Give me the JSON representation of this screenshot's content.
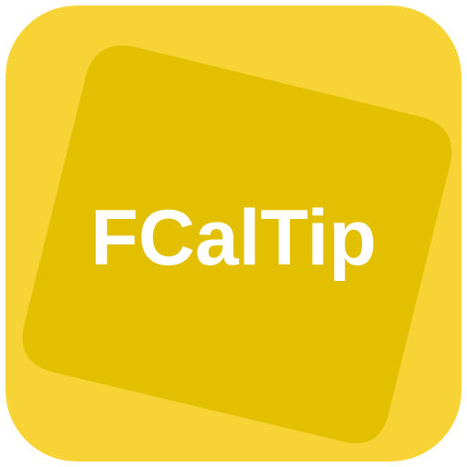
{
  "app": {
    "name": "FCalTip"
  },
  "colors": {
    "background": "#f8d335",
    "tile": "#e2c001",
    "text": "#ffffff"
  }
}
